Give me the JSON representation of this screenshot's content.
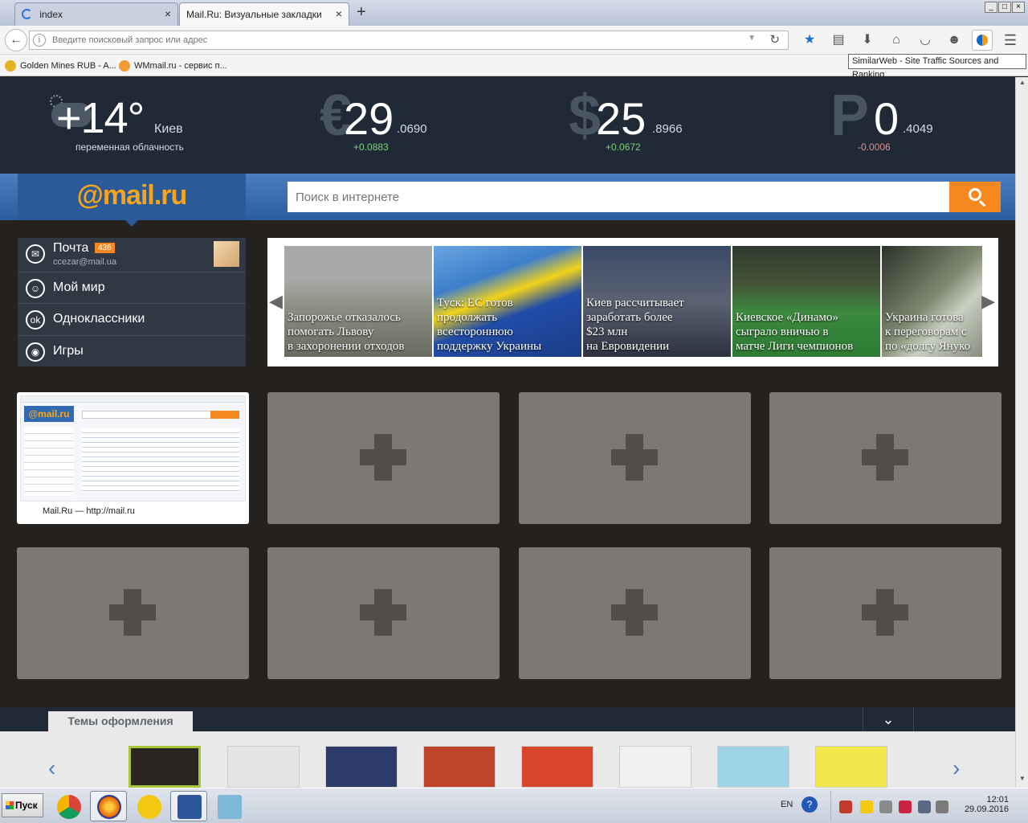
{
  "browser": {
    "tabs": [
      {
        "title": "index",
        "active": false
      },
      {
        "title": "Mail.Ru: Визуальные закладки",
        "active": true
      }
    ],
    "new_tab": "+",
    "window_buttons": [
      "_",
      "□",
      "×"
    ],
    "url_placeholder": "Введите поисковый запрос или адрес",
    "bookmarks": [
      "Golden Mines RUB - A...",
      "WMmail.ru - сервис п..."
    ],
    "tooltip": "SimilarWeb - Site Traffic Sources and Ranking",
    "toolbar_icons": [
      "star-icon",
      "reading-list-icon",
      "download-icon",
      "home-icon",
      "pocket-icon",
      "emoji-icon",
      "similarweb-icon",
      "menu-icon"
    ]
  },
  "infobar": {
    "weather": {
      "temp": "+14°",
      "city": "Киев",
      "desc": "переменная облачность"
    },
    "rates": [
      {
        "symbol": "€",
        "integer": "29",
        "fraction": ".0690",
        "change": "+0.0883",
        "direction": "up"
      },
      {
        "symbol": "$",
        "integer": "25",
        "fraction": ".8966",
        "change": "+0.0672",
        "direction": "up"
      },
      {
        "symbol": "Р",
        "integer": "0",
        "fraction": ".4049",
        "change": "-0.0006",
        "direction": "down"
      }
    ]
  },
  "search": {
    "logo": "@mail.ru",
    "placeholder": "Поиск в интернете"
  },
  "services": [
    {
      "label": "Почта",
      "badge": "436",
      "email": "ccezar@mail.ua",
      "icon": "mail-icon"
    },
    {
      "label": "Мой мир",
      "icon": "my-world-icon"
    },
    {
      "label": "Одноклассники",
      "icon": "odnoklassniki-icon"
    },
    {
      "label": "Игры",
      "icon": "games-icon"
    }
  ],
  "news": [
    {
      "lines": [
        "Запорожье отказалось",
        "помогать Львову",
        "в захоронении отходов"
      ]
    },
    {
      "lines": [
        "Туск: ЕС готов",
        "продолжать",
        "всестороннюю",
        "поддержку Украины"
      ]
    },
    {
      "lines": [
        "Киев рассчитывает",
        "заработать более",
        "$23 млн",
        "на Евровидении"
      ]
    },
    {
      "lines": [
        "Киевское «Динамо»",
        "сыграло вничью в",
        "матче Лиги чемпионов"
      ]
    },
    {
      "lines": [
        "Украина готова",
        "к переговорам с",
        "по «долгу Януко"
      ]
    }
  ],
  "bookmark_tiles": {
    "filled_caption": "Mail.Ru — http://mail.ru",
    "thumb_logo": "@mail.ru",
    "empty_count": 7
  },
  "themes": {
    "tab_label": "Темы оформления",
    "colors": [
      "#2b2522",
      "#e4e4e4",
      "#2d3b6a",
      "#c0442a",
      "#d9452a",
      "#f1f1f1",
      "#9fd4e8",
      "#f3e64a"
    ]
  },
  "taskbar": {
    "start": "Пуск",
    "lang": "EN",
    "help": "?",
    "time": "12:01",
    "date": "29.09.2016"
  }
}
